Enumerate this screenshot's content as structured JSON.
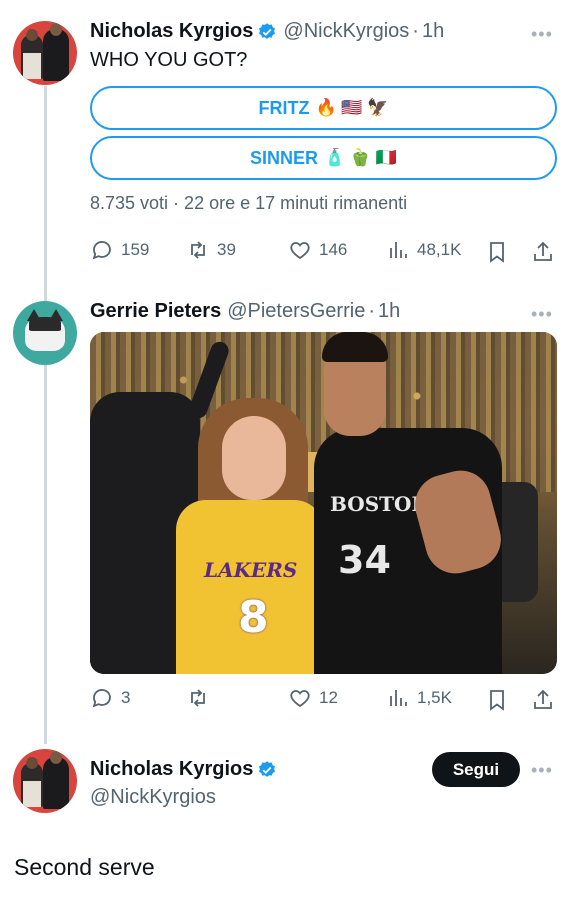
{
  "tweet1": {
    "name": "Nicholas Kyrgios",
    "handle": "@NickKyrgios",
    "time": "1h",
    "text": "WHO YOU GOT?",
    "poll": {
      "options": [
        {
          "label": "FRITZ",
          "emoji": "🔥 🇺🇸 🦅"
        },
        {
          "label": "SINNER",
          "emoji": "🧴 🫑 🇮🇹"
        }
      ],
      "meta": "8.735 voti · 22 ore e 17 minuti rimanenti"
    },
    "actions": {
      "replies": "159",
      "reposts": "39",
      "likes": "146",
      "views": "48,1K"
    }
  },
  "tweet2": {
    "name": "Gerrie Pieters",
    "handle": "@PietersGerrie",
    "time": "1h",
    "photo": {
      "jersey_left_text": "LAKERS",
      "jersey_left_number": "8",
      "jersey_right_text": "BOSTON",
      "jersey_right_number": "34"
    },
    "actions": {
      "replies": "3",
      "reposts": "",
      "likes": "12",
      "views": "1,5K"
    }
  },
  "tweet3": {
    "name": "Nicholas Kyrgios",
    "handle": "@NickKyrgios",
    "follow_label": "Segui",
    "text": "Second serve"
  },
  "ui": {
    "dot": "·",
    "more": "•••"
  },
  "colors": {
    "accent": "#1d9bf0",
    "text": "#0f1419",
    "muted": "#536471",
    "line": "#cfd9de"
  }
}
